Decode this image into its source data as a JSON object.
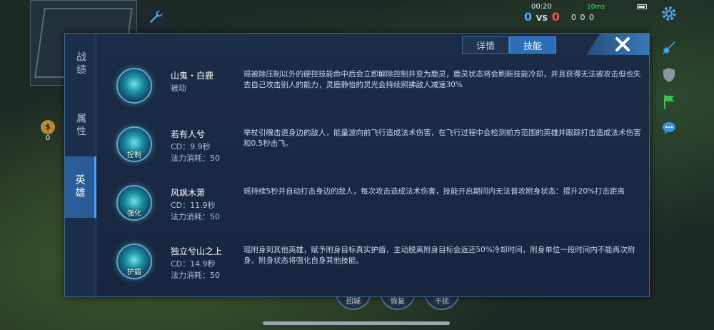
{
  "hud": {
    "time": "00:20",
    "score_blue": "0",
    "score_vs": "VS",
    "score_red": "0",
    "kda": "0  0  0",
    "ping": "10ms",
    "gold": "0"
  },
  "bottom_skills": [
    "回城",
    "恢复",
    "干扰"
  ],
  "side_tabs": [
    "战绩",
    "属性",
    "英雄"
  ],
  "top_tabs": [
    "详情",
    "技能"
  ],
  "skills": [
    {
      "name": "山鬼・白鹿",
      "line1": "被动",
      "line2": "",
      "tag": "",
      "desc": "瑶被除压制以外的硬控技能命中后会立即解除控制并变为鹿灵，鹿灵状态将会刷新技能冷却，并且获得无法被攻击但也失去自己攻击别人的能力，灵鹿静怡的灵光会持续照拂敌人减速30%"
    },
    {
      "name": "若有人兮",
      "line1": "CD：9.9秒",
      "line2": "法力消耗：50",
      "tag": "控制",
      "desc": "举杖引魄击退身边的敌人，能量波向前飞行造成法术伤害，在飞行过程中会检测前方范围的英雄并跟踪打击造成法术伤害和0.5秒击飞。"
    },
    {
      "name": "风飒木萧",
      "line1": "CD：11.9秒",
      "line2": "法力消耗：50",
      "tag": "强化",
      "desc": "瑶持续5秒并自动打击身边的敌人，每次攻击造成法术伤害，技能开启期间内无法普攻附身状态：提升20%打击距离"
    },
    {
      "name": "独立兮山之上",
      "line1": "CD：14.9秒",
      "line2": "法力消耗：50",
      "tag": "护盾",
      "desc": "瑶附身到其他英雄，赋予附身目标真实护盾，主动脱离附身目标会返还50%冷却时间，附身单位一段时间内不能再次附身。附身状态将强化自身其他技能。"
    }
  ]
}
